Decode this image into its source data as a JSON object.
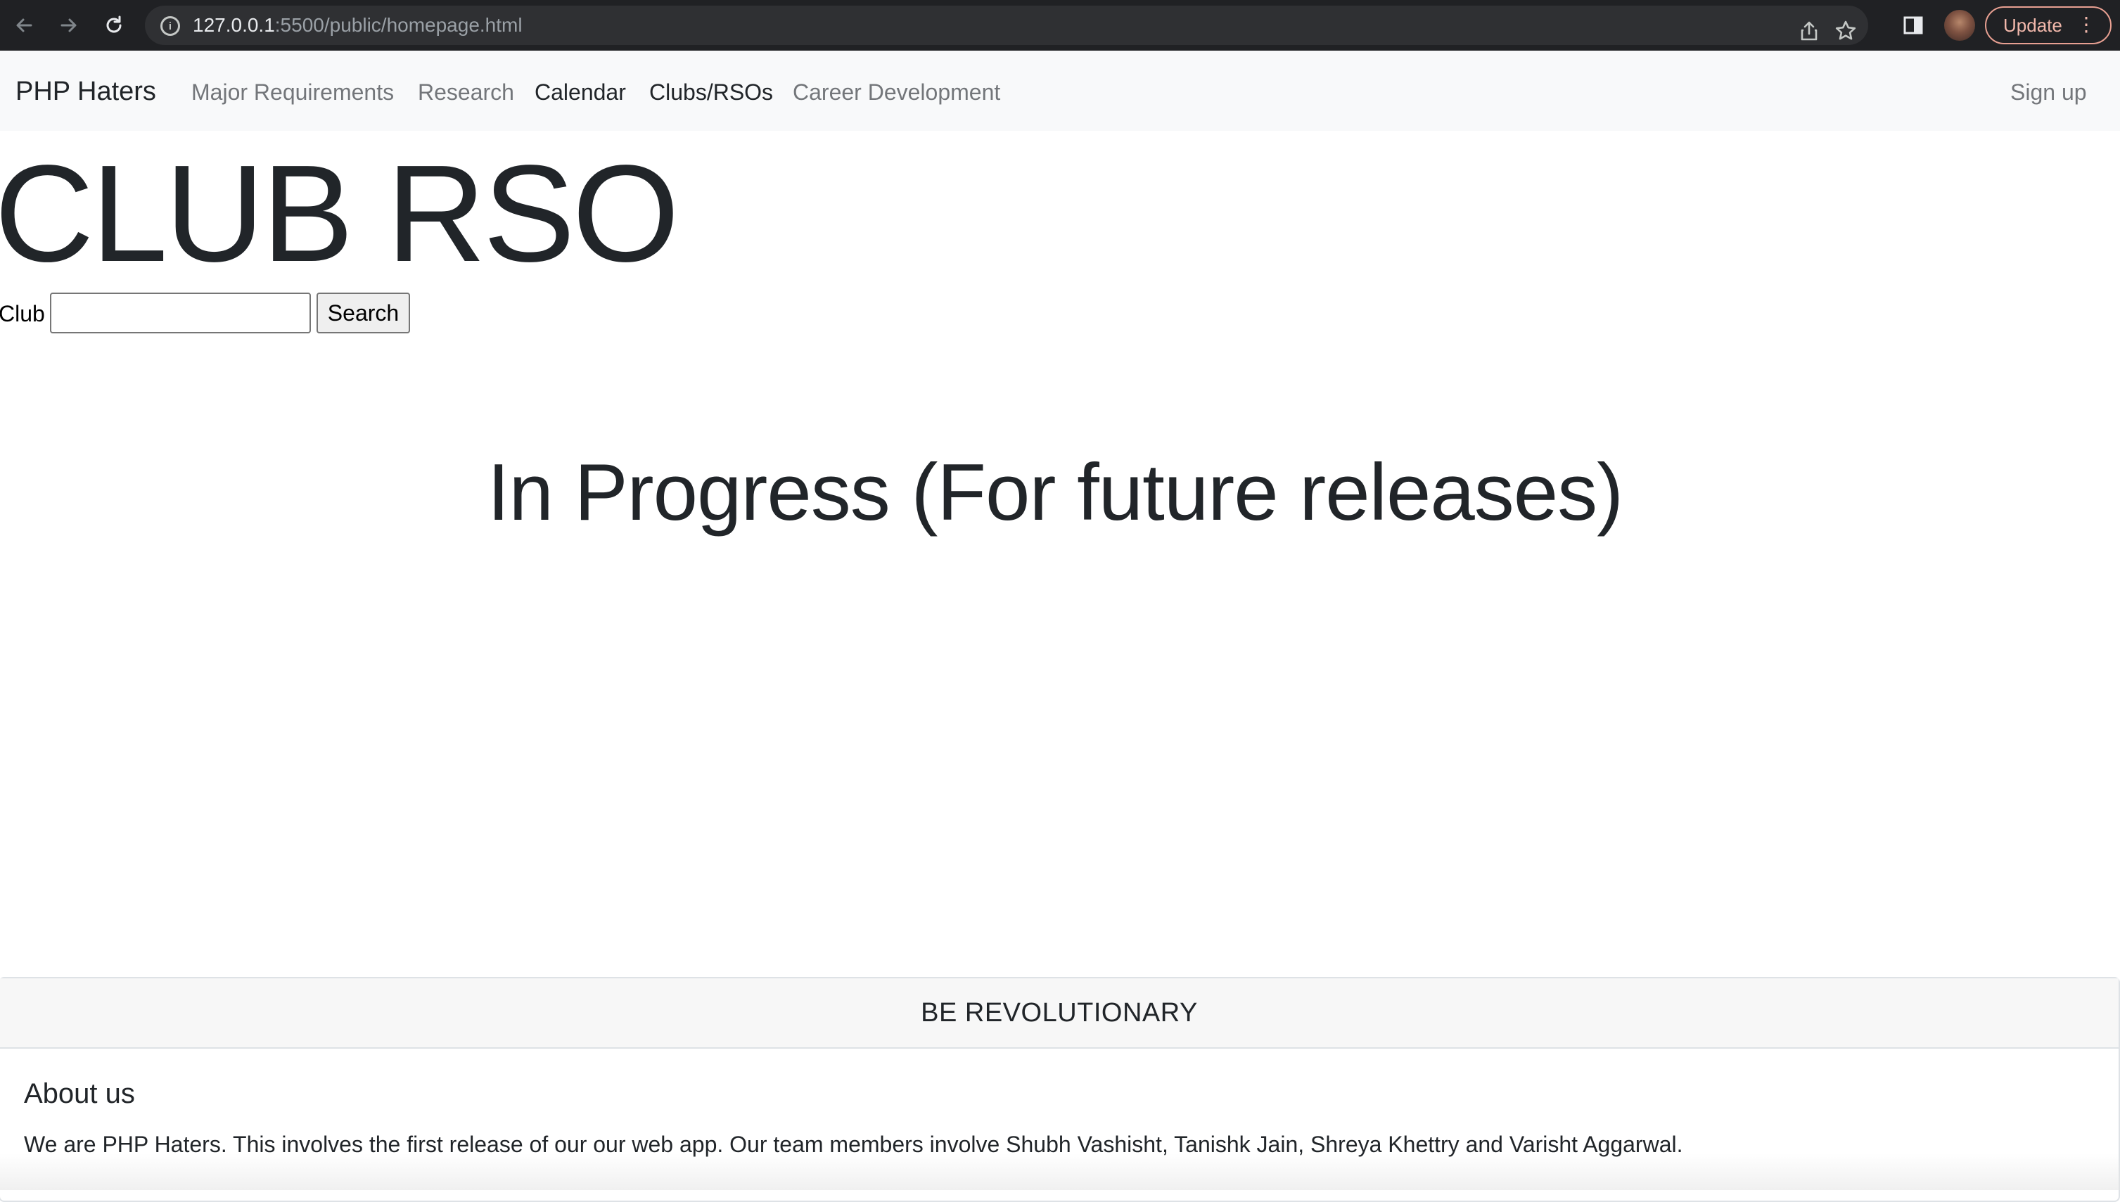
{
  "browser": {
    "url_host": "127.0.0.1",
    "url_path": ":5500/public/homepage.html",
    "update_label": "Update",
    "icons": [
      "back-arrow-icon",
      "forward-arrow-icon",
      "reload-icon",
      "info-icon",
      "share-icon",
      "star-icon",
      "sidebar-icon",
      "profile-avatar",
      "more-vertical-icon"
    ]
  },
  "navbar": {
    "brand": "PHP Haters",
    "links": [
      {
        "label": "Major Requirements"
      },
      {
        "label": "Research"
      },
      {
        "label": "Calendar"
      },
      {
        "label": "Clubs/RSOs"
      },
      {
        "label": "Career Development"
      }
    ],
    "signup": "Sign up"
  },
  "main": {
    "title": "CLUB RSO",
    "search": {
      "label": "Club",
      "value": "",
      "button": "Search"
    },
    "status": "In Progress (For future releases)"
  },
  "footer": {
    "header": "BE REVOLUTIONARY",
    "title": "About us",
    "text": "We are PHP Haters. This involves the first release of our our web app. Our team members involve Shubh Vashisht, Tanishk Jain, Shreya Khettry and Varisht Aggarwal."
  },
  "colors": {
    "browser_bg": "#202124",
    "navbar_bg": "#f8f9fa",
    "text": "#212529",
    "muted_link": "#73767a",
    "update_accent": "#f2b8ab"
  }
}
